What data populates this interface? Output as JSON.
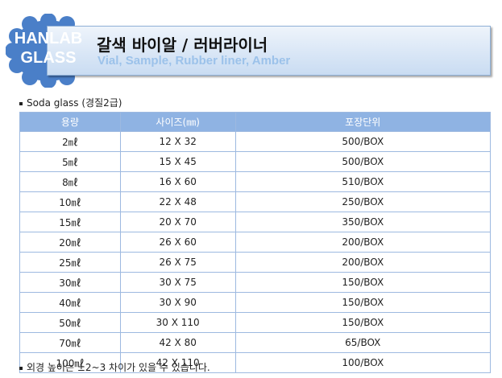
{
  "header": {
    "badge_line1": "HANLAB",
    "badge_line2": "GLASS",
    "title": "갈색 바이알 / 러버라이너",
    "subtitle": "Vial, Sample, Rubber liner, Amber",
    "badge_color": "#4a7fc8",
    "subtitle_color": "#9cc2ea"
  },
  "material_note": "Soda glass (경질2급)",
  "table": {
    "columns": [
      "용량",
      "사이즈(㎜)",
      "포장단위"
    ],
    "rows": [
      [
        "2㎖",
        "12 X 32",
        "500/BOX"
      ],
      [
        "5㎖",
        "15 X 45",
        "500/BOX"
      ],
      [
        "8㎖",
        "16 X 60",
        "510/BOX"
      ],
      [
        "10㎖",
        "22 X 48",
        "250/BOX"
      ],
      [
        "15㎖",
        "20 X 70",
        "350/BOX"
      ],
      [
        "20㎖",
        "26 X 60",
        "200/BOX"
      ],
      [
        "25㎖",
        "26 X 75",
        "200/BOX"
      ],
      [
        "30㎖",
        "30 X 75",
        "150/BOX"
      ],
      [
        "40㎖",
        "30 X 90",
        "150/BOX"
      ],
      [
        "50㎖",
        "30 X 110",
        "150/BOX"
      ],
      [
        "70㎖",
        "42 X 80",
        "65/BOX"
      ],
      [
        "100㎖",
        "42 X 110",
        "100/BOX"
      ]
    ]
  },
  "footnote": "외경 높이는 ±2~3 차이가 있을 수 있습니다."
}
